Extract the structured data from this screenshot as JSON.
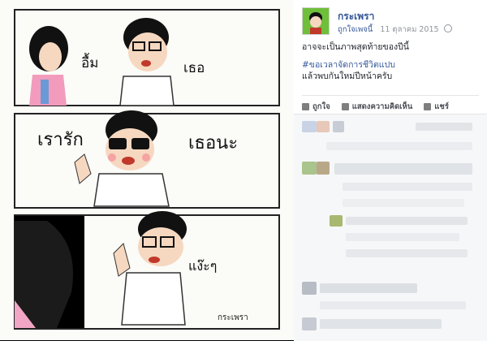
{
  "post": {
    "page_name": "กระเพรา",
    "like_page_label": "ถูกใจเพจนี้",
    "date": "11 ตุลาคม 2015",
    "caption_line1": "อาจจะเป็นภาพสุดท้ายของปีนี้",
    "hashtag": "#ขอเวลาจัดการชีวิตแปบ",
    "caption_line3": "แล้วพบกันใหม่ปีหน้าครับ"
  },
  "actions": {
    "like": "ถูกใจ",
    "comment": "แสดงความคิดเห็น",
    "share": "แชร์"
  },
  "comic": {
    "panel1_left": "อื้ม",
    "panel1_right": "เธอ",
    "panel2_left": "เรารัก",
    "panel2_right": "เธอนะ",
    "panel3_right": "แง๊ะๆ",
    "signature": "กระเพรา"
  }
}
